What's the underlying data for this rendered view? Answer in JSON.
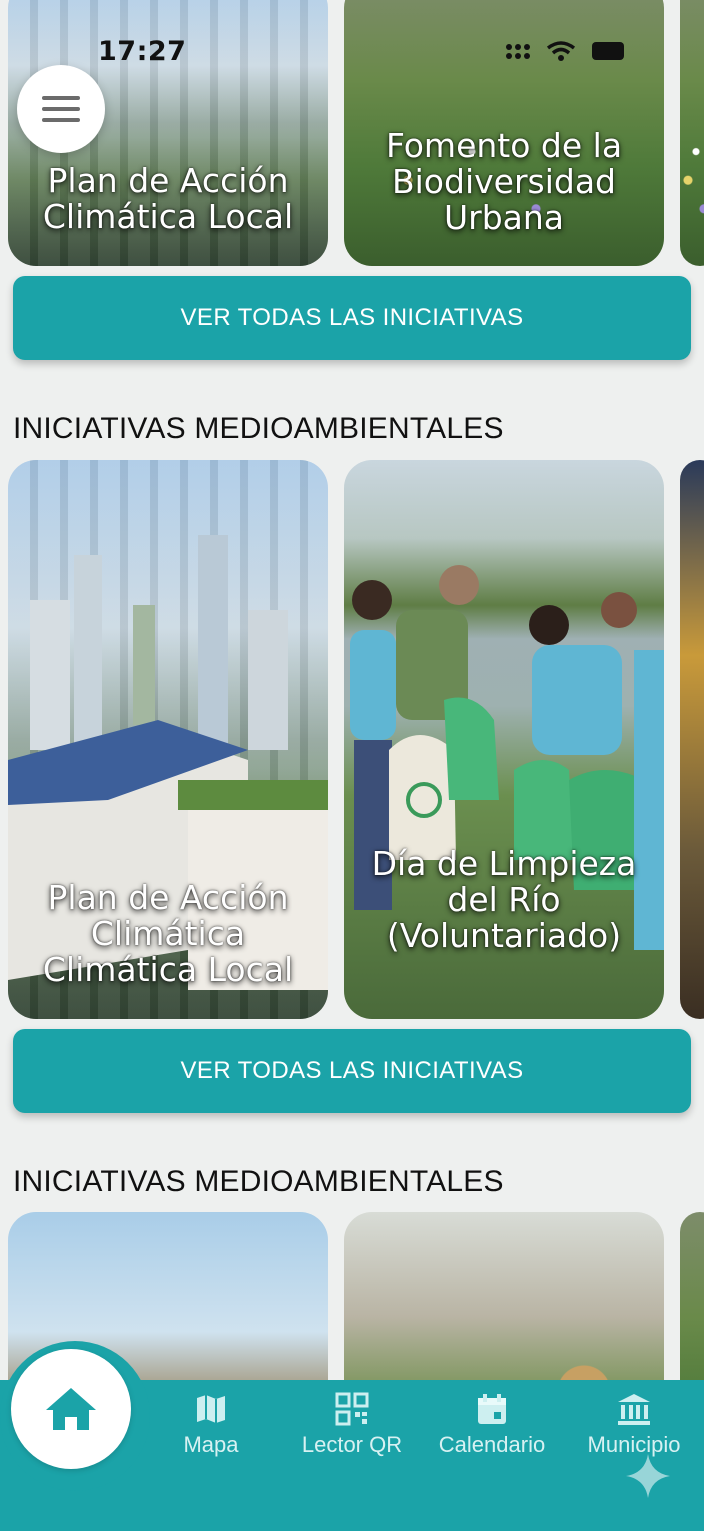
{
  "status_bar": {
    "time": "17:27"
  },
  "menu": {
    "icon": "hamburger-menu-icon"
  },
  "sections": [
    {
      "cards": [
        {
          "title": "Plan de Acción Climática Local"
        },
        {
          "title": "Fomento de la Biodiversidad Urbana"
        }
      ],
      "button_label": "VER TODAS LAS INICIATIVAS"
    },
    {
      "heading": "INICIATIVAS MEDIOAMBIENTALES",
      "cards": [
        {
          "title": "Plan de Acción Climática Climática Local"
        },
        {
          "title": "Día de Limpieza del Río (Voluntariado)"
        }
      ],
      "button_label": "VER TODAS LAS INICIATIVAS"
    },
    {
      "heading": "INICIATIVAS MEDIOAMBIENTALES",
      "cards": [
        {
          "title": ""
        },
        {
          "title": ""
        }
      ]
    }
  ],
  "bottom_nav": {
    "items": [
      {
        "label": "",
        "icon": "home-icon",
        "active": true
      },
      {
        "label": "Mapa",
        "icon": "map-icon"
      },
      {
        "label": "Lector QR",
        "icon": "qr-code-icon"
      },
      {
        "label": "Calendario",
        "icon": "calendar-icon"
      },
      {
        "label": "Municipio",
        "icon": "town-hall-icon"
      }
    ]
  },
  "colors": {
    "accent": "#1ba3a8",
    "background": "#eef0ef",
    "text": "#111111"
  }
}
